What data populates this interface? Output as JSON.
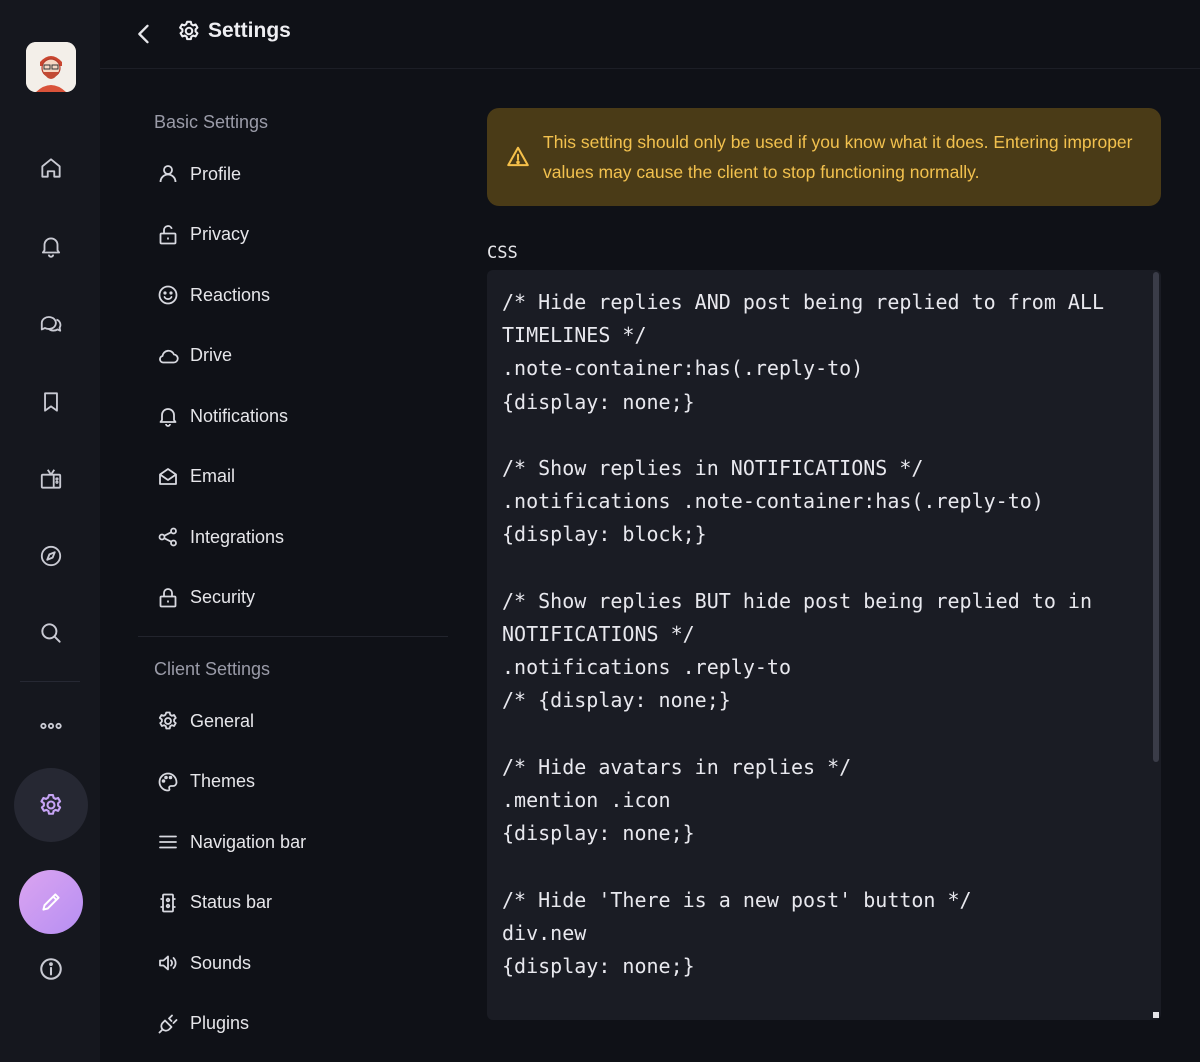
{
  "header": {
    "title": "Settings"
  },
  "rail": {
    "icons": [
      "home-icon",
      "bell-icon",
      "chat-icon",
      "bookmark-icon",
      "tv-icon",
      "compass-icon",
      "search-icon",
      "more-icon",
      "settings-icon",
      "pencil-icon",
      "info-icon"
    ]
  },
  "nav": {
    "basic_title": "Basic Settings",
    "basic": [
      {
        "label": "Profile",
        "icon": "user-icon"
      },
      {
        "label": "Privacy",
        "icon": "lock-open-icon"
      },
      {
        "label": "Reactions",
        "icon": "smiley-icon"
      },
      {
        "label": "Drive",
        "icon": "cloud-icon"
      },
      {
        "label": "Notifications",
        "icon": "bell-icon"
      },
      {
        "label": "Email",
        "icon": "envelope-icon"
      },
      {
        "label": "Integrations",
        "icon": "share-icon"
      },
      {
        "label": "Security",
        "icon": "lock-icon"
      }
    ],
    "client_title": "Client Settings",
    "client": [
      {
        "label": "General",
        "icon": "gear-icon"
      },
      {
        "label": "Themes",
        "icon": "palette-icon"
      },
      {
        "label": "Navigation bar",
        "icon": "menu-icon"
      },
      {
        "label": "Status bar",
        "icon": "status-bar-icon"
      },
      {
        "label": "Sounds",
        "icon": "speaker-icon"
      },
      {
        "label": "Plugins",
        "icon": "plug-icon"
      }
    ]
  },
  "warning": {
    "text": "This setting should only be used if you know what it does. Entering improper values may cause the client to stop functioning normally."
  },
  "css_editor": {
    "label": "CSS",
    "value": "/* Hide replies AND post being replied to from ALL TIMELINES */\n.note-container:has(.reply-to)\n{display: none;}\n\n/* Show replies in NOTIFICATIONS */\n.notifications .note-container:has(.reply-to)\n{display: block;}\n\n/* Show replies BUT hide post being replied to in NOTIFICATIONS */\n.notifications .reply-to\n/* {display: none;}\n\n/* Hide avatars in replies */\n.mention .icon\n{display: none;}\n\n/* Hide 'There is a new post' button */\ndiv.new\n{display: none;}"
  },
  "colors": {
    "accent": "#c6a4f5",
    "warning_bg": "#4a3b17",
    "warning_text": "#f2c14e"
  }
}
